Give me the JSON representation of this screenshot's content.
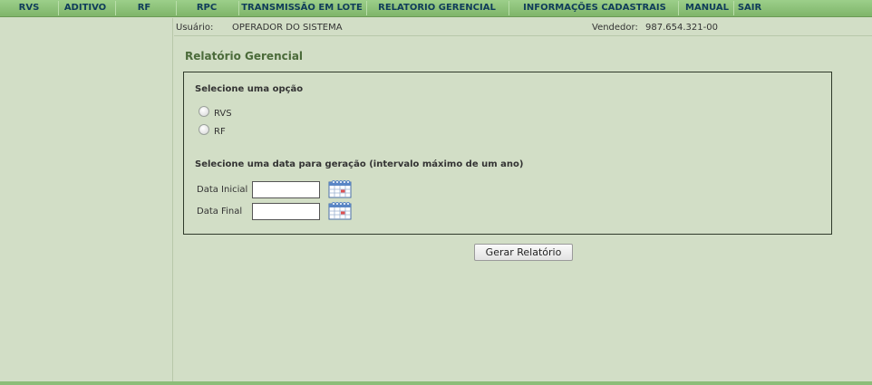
{
  "nav": {
    "items": [
      {
        "label": "RVS"
      },
      {
        "label": "ADITIVO"
      },
      {
        "label": "RF"
      },
      {
        "label": "RPC"
      },
      {
        "label": "TRANSMISSÃO EM LOTE"
      },
      {
        "label": "RELATORIO GERENCIAL"
      },
      {
        "label": "INFORMAÇÕES CADASTRAIS"
      },
      {
        "label": "MANUAL"
      },
      {
        "label": "SAIR"
      }
    ]
  },
  "info": {
    "user_label": "Usuário:",
    "user_value": "OPERADOR DO SISTEMA",
    "vendor_label": "Vendedor:",
    "vendor_value": "987.654.321-00"
  },
  "page": {
    "title": "Relatório Gerencial",
    "option_heading": "Selecione uma opção",
    "options": [
      {
        "label": "RVS",
        "selected": false
      },
      {
        "label": "RF",
        "selected": false
      }
    ],
    "date_heading": "Selecione uma data para geração (intervalo máximo de um ano)",
    "start_date": {
      "label": "Data Inicial",
      "value": ""
    },
    "end_date": {
      "label": "Data Final",
      "value": ""
    },
    "submit_label": "Gerar Relatório"
  },
  "icons": {
    "calendar": "calendar-icon"
  },
  "colors": {
    "background": "#d2dec6",
    "nav": "#8cc47a",
    "nav_text": "#0f3c5a",
    "title": "#4b6b3a"
  }
}
